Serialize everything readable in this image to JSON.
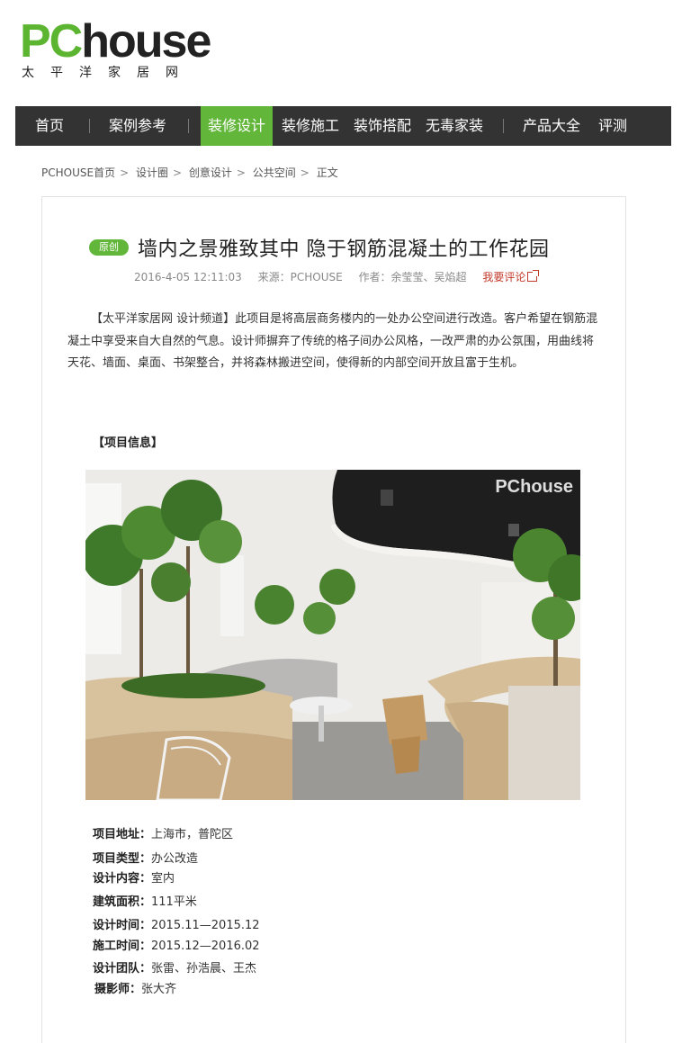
{
  "logo": {
    "pc": "PC",
    "house": "house",
    "subtitle": "太平洋家居网"
  },
  "nav": {
    "items": [
      {
        "label": "首页"
      },
      {
        "label": "案例参考"
      },
      {
        "label": "装修设计",
        "active": true
      },
      {
        "label": "装修施工"
      },
      {
        "label": "装饰搭配"
      },
      {
        "label": "无毒家装"
      },
      {
        "label": "产品大全"
      },
      {
        "label": "评测"
      }
    ],
    "bg_color": "#333333",
    "active_color": "#62b63a"
  },
  "breadcrumb": [
    "PCHOUSE首页",
    "设计圈",
    "创意设计",
    "公共空间",
    "正文"
  ],
  "article": {
    "badge": "原创",
    "title": "墙内之景雅致其中 隐于钢筋混凝土的工作花园",
    "date": "2016-4-05 12:11:03",
    "source": "来源：PCHOUSE",
    "author": "作者：余莹莹、吴焰超",
    "comment_link": "我要评论",
    "intro": "【太平洋家居网 设计频道】此项目是将高层商务楼内的一处办公空间进行改造。客户希望在钢筋混凝土中享受来自大自然的气息。设计师摒弃了传统的格子间办公风格，一改严肃的办公氛围，用曲线将天花、墙面、桌面、书架整合，并将森林搬进空间，使得新的内部空间开放且富于生机。",
    "section_title": "【项目信息】",
    "photo_watermark": "PChouse",
    "info": [
      {
        "label": "项目地址：",
        "value": "上海市，普陀区"
      },
      {
        "label": "项目类型：",
        "value": "办公改造"
      },
      {
        "label": "设计内容：",
        "value": "室内"
      },
      {
        "label": "建筑面积：",
        "value": "111平米"
      },
      {
        "label": "设计时间：",
        "value": "2015.11—2015.12"
      },
      {
        "label": "施工时间：",
        "value": "2015.12—2016.02"
      },
      {
        "label": "设计团队：",
        "value": "张雷、孙浩晨、王杰"
      },
      {
        "label": "摄影师：",
        "value": "张大齐"
      }
    ]
  }
}
